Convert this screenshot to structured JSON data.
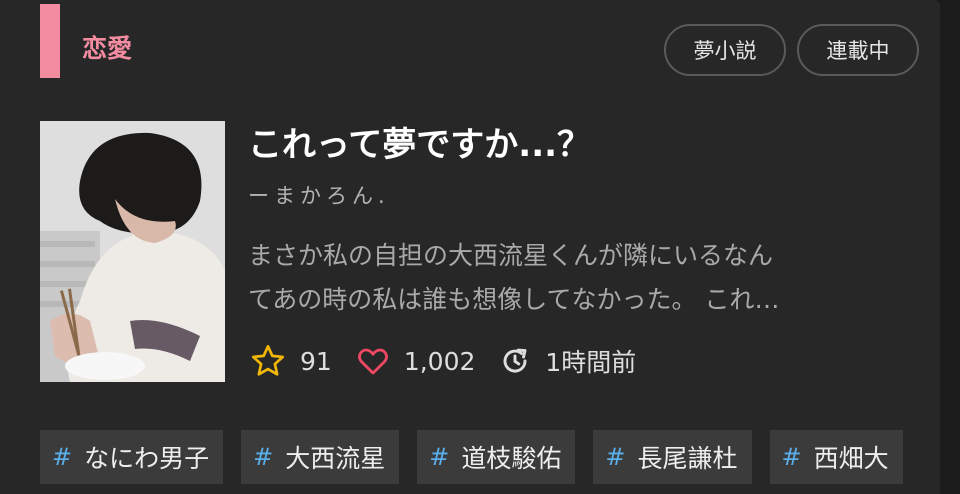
{
  "genre": {
    "label": "恋愛",
    "color": "#f38ca1"
  },
  "chips": [
    "夢小説",
    "連載中"
  ],
  "story": {
    "title": "これって夢ですか...？",
    "author": "ーまかろん.",
    "description_lines": [
      "まさか私の自担の大西流星くんが隣にいるなん",
      "てあの時の私は誰も想像してなかった。 これ…"
    ],
    "thumbnail_icon": "person-photo-thumbnail"
  },
  "stats": {
    "stars": "91",
    "hearts": "1,002",
    "updated": "1時間前",
    "star_icon": "star-icon",
    "heart_icon": "heart-icon",
    "clock_icon": "refresh-clock-icon"
  },
  "tags": [
    {
      "hash": "#",
      "label": "なにわ男子"
    },
    {
      "hash": "#",
      "label": "大西流星"
    },
    {
      "hash": "#",
      "label": "道枝駿佑"
    },
    {
      "hash": "#",
      "label": "長尾謙杜"
    },
    {
      "hash": "#",
      "label": "西畑大"
    }
  ]
}
